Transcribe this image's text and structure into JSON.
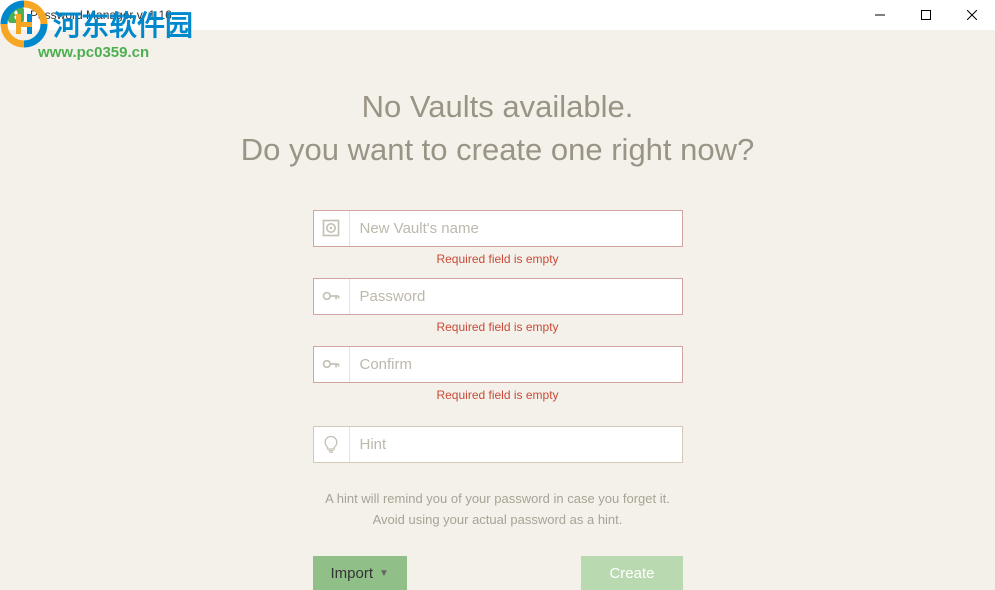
{
  "titlebar": {
    "title": "Password Manager v. 1.16"
  },
  "watermark": {
    "text": "河东软件园",
    "url": "www.pc0359.cn"
  },
  "heading": {
    "line1": "No Vaults available.",
    "line2": "Do you want to create one right now?"
  },
  "fields": {
    "vault_name": {
      "placeholder": "New Vault's name",
      "error": "Required field is empty"
    },
    "password": {
      "placeholder": "Password",
      "error": "Required field is empty"
    },
    "confirm": {
      "placeholder": "Confirm",
      "error": "Required field is empty"
    },
    "hint": {
      "placeholder": "Hint"
    }
  },
  "hint_description": {
    "line1": "A hint will remind you of your password in case you forget it.",
    "line2": "Avoid using your actual password as a hint."
  },
  "buttons": {
    "import": "Import",
    "create": "Create"
  }
}
